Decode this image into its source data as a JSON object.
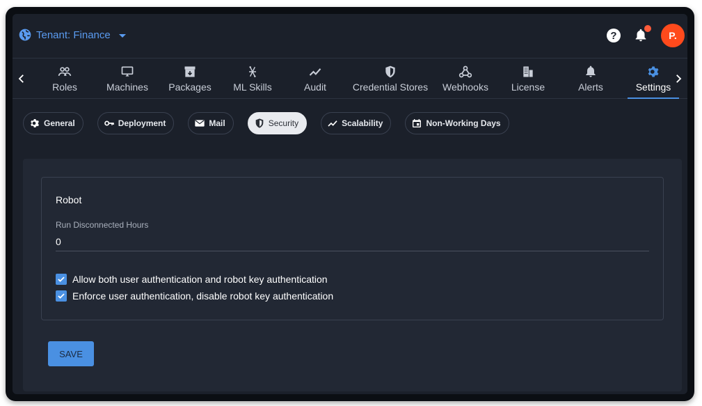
{
  "header": {
    "tenant_label": "Tenant: Finance",
    "avatar_initial": "P."
  },
  "nav": {
    "tabs": [
      {
        "label": "Roles",
        "icon": "people-icon"
      },
      {
        "label": "Machines",
        "icon": "monitor-icon"
      },
      {
        "label": "Packages",
        "icon": "package-icon"
      },
      {
        "label": "ML Skills",
        "icon": "ml-skills-icon"
      },
      {
        "label": "Audit",
        "icon": "trend-icon"
      },
      {
        "label": "Credential Stores",
        "icon": "shield-icon"
      },
      {
        "label": "Webhooks",
        "icon": "webhook-icon"
      },
      {
        "label": "License",
        "icon": "building-icon"
      },
      {
        "label": "Alerts",
        "icon": "bell-icon"
      },
      {
        "label": "Settings",
        "icon": "gear-icon"
      }
    ],
    "active": "Settings"
  },
  "subtabs": {
    "items": [
      {
        "label": "General",
        "icon": "gear-icon"
      },
      {
        "label": "Deployment",
        "icon": "key-icon"
      },
      {
        "label": "Mail",
        "icon": "mail-icon"
      },
      {
        "label": "Security",
        "icon": "shield-icon"
      },
      {
        "label": "Scalability",
        "icon": "trend-icon"
      },
      {
        "label": "Non-Working Days",
        "icon": "calendar-icon"
      }
    ],
    "active": "Security"
  },
  "robot": {
    "title": "Robot",
    "field_label": "Run Disconnected Hours",
    "field_value": "0",
    "options": [
      "Allow both user authentication and robot key authentication",
      "Enforce user authentication, disable robot key authentication"
    ]
  },
  "actions": {
    "save_label": "SAVE"
  },
  "colors": {
    "accent": "#4a90e2",
    "tenant_text": "#5a9bf0",
    "avatar_bg": "#ff4a1c",
    "badge": "#ff5b3a",
    "background": "#1b202a"
  }
}
